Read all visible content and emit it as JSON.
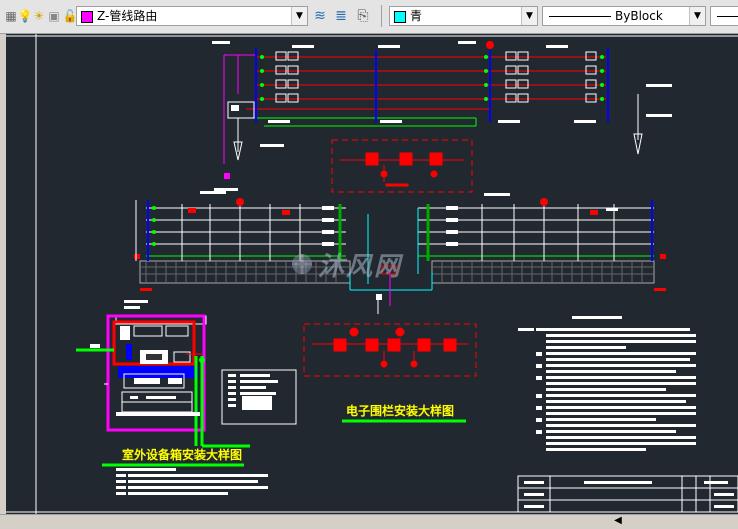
{
  "toolbar": {
    "layer": {
      "name": "Z-管线路由",
      "swatch_color": "#ff00ff",
      "icons": [
        "bulb-icon",
        "sun-icon",
        "lock-icon"
      ]
    },
    "layer_tools": [
      "layer-props-icon",
      "layer-state-icon",
      "layer-previous-icon"
    ],
    "color": {
      "name": "青",
      "swatch_color": "#00ffff"
    },
    "linetype": {
      "name": "ByBlock"
    }
  },
  "drawing": {
    "title_outdoor": "室外设备箱安装大样图",
    "title_fence": "电子围栏安装大样图",
    "watermark": "沐风网",
    "colors": {
      "background": "#212830",
      "red": "#ff0000",
      "green": "#00ff00",
      "magenta": "#ff00ff",
      "blue": "#0000ff",
      "yellow": "#ffff00",
      "white": "#ffffff",
      "cyan": "#00ffff"
    }
  }
}
